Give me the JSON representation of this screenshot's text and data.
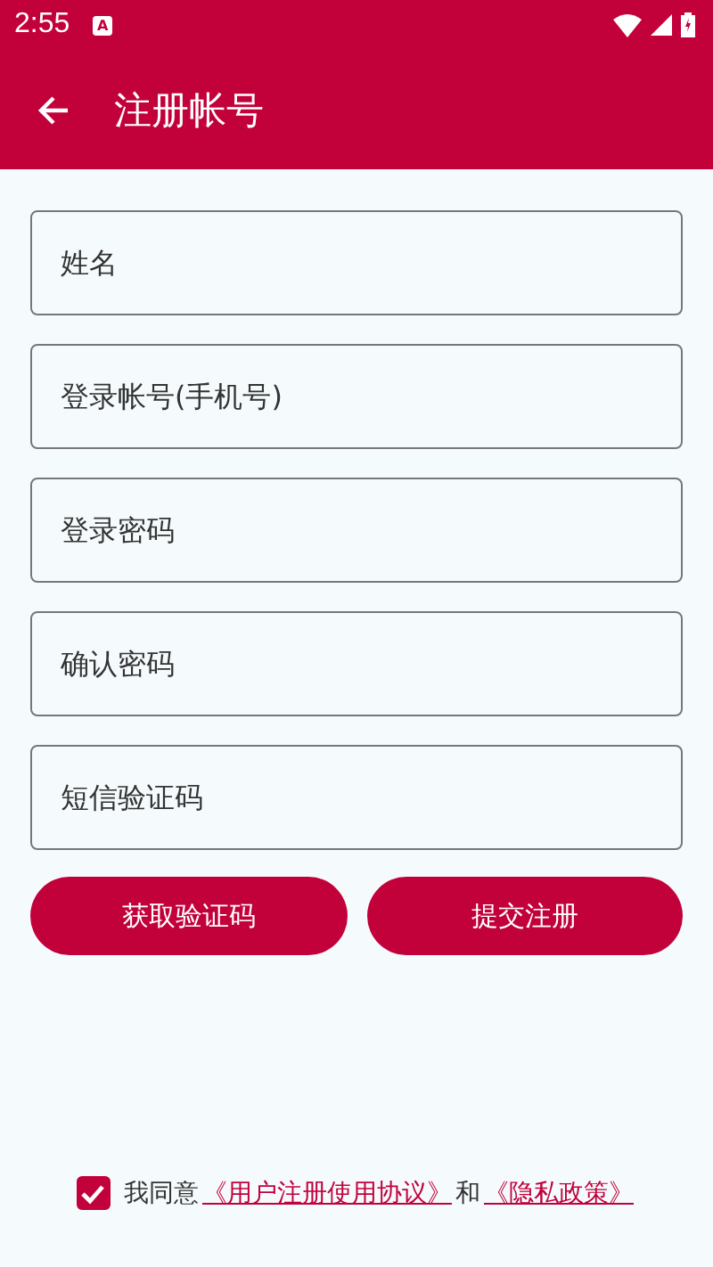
{
  "status_bar": {
    "time": "2:55",
    "notification_icon": "A"
  },
  "app_bar": {
    "title": "注册帐号"
  },
  "fields": [
    {
      "placeholder": "姓名"
    },
    {
      "placeholder": "登录帐号(手机号)"
    },
    {
      "placeholder": "登录密码"
    },
    {
      "placeholder": "确认密码"
    },
    {
      "placeholder": "短信验证码"
    }
  ],
  "buttons": [
    "获取验证码",
    "提交注册"
  ],
  "agreement": {
    "checked": true,
    "prefix": "我同意",
    "link_1": "《用户注册使用协议》",
    "joiner": "和",
    "link_2": "《隐私政策》"
  }
}
